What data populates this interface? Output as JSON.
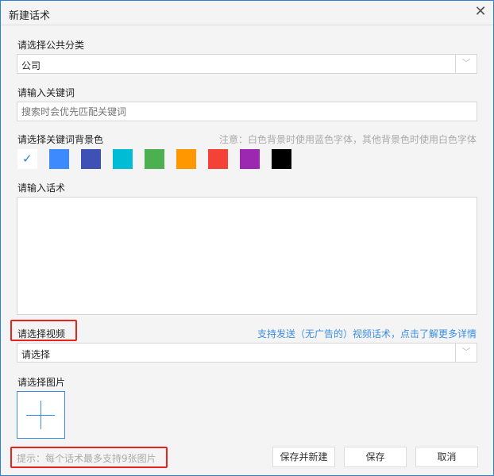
{
  "dialog": {
    "title": "新建话术",
    "close_icon": "close-icon"
  },
  "category": {
    "label": "请选择公共分类",
    "value": "公司"
  },
  "keyword": {
    "label": "请输入关键词",
    "placeholder": "搜索时会优先匹配关键词",
    "value": ""
  },
  "bg_color": {
    "label": "请选择关键词背景色",
    "note": "注意：白色背景时使用蓝色字体，其他背景色时使用白色字体",
    "colors": [
      "#ffffff",
      "#3d8aff",
      "#3f51b5",
      "#00bcd4",
      "#4caf50",
      "#ff9800",
      "#f44336",
      "#9c27b0",
      "#000000"
    ],
    "selected_index": 0
  },
  "script": {
    "label": "请输入话术",
    "value": ""
  },
  "video": {
    "label": "请选择视频",
    "link": "支持发送（无广告的）视频话术，点击了解更多详情",
    "value": "请选择"
  },
  "image": {
    "label": "请选择图片"
  },
  "footer": {
    "hint": "提示：每个话术最多支持9张图片",
    "save_new": "保存并新建",
    "save": "保存",
    "cancel": "取消"
  },
  "colors": {
    "accent": "#2b7fd6",
    "highlight": "#e8231b"
  }
}
